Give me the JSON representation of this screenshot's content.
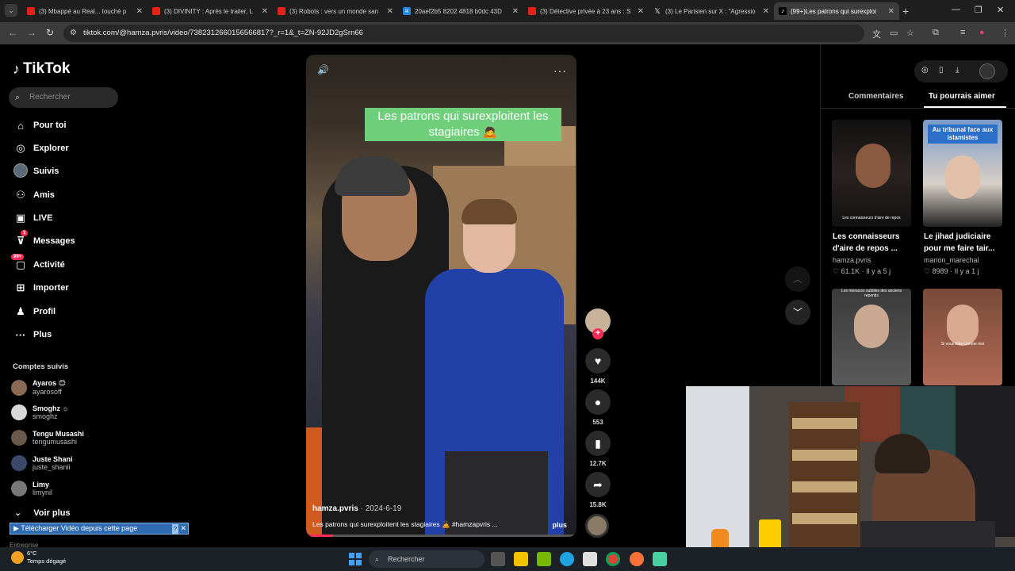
{
  "browser": {
    "tabs": [
      {
        "title": "(3) Mbappé au Real... touché p",
        "icon": "youtube-icon",
        "active": false
      },
      {
        "title": "(3) DIVINITY : Après le trailer, L",
        "icon": "youtube-icon",
        "active": false
      },
      {
        "title": "(3) Robots : vers un monde san",
        "icon": "youtube-icon",
        "active": false
      },
      {
        "title": "20aef2b5 8202 4818 b0dc 43D",
        "icon": "document-icon",
        "active": false
      },
      {
        "title": "(3) Détective privée à 23 ans : S",
        "icon": "youtube-icon",
        "active": false
      },
      {
        "title": "(3) Le Parisien sur X : \"Agressio",
        "icon": "x-icon",
        "active": false
      },
      {
        "title": "(99+)Les patrons qui surexploi",
        "icon": "tiktok-icon",
        "active": true
      }
    ],
    "url": "tiktok.com/@hamza.pvris/video/7382312660156566817?_r=1&_t=ZN-92JD2gSrn66"
  },
  "sidebar": {
    "logo": "TikTok",
    "search_placeholder": "Rechercher",
    "nav": [
      {
        "label": "Pour toi",
        "icon": "home-icon"
      },
      {
        "label": "Explorer",
        "icon": "compass-icon"
      },
      {
        "label": "Suivis",
        "icon": "following-icon"
      },
      {
        "label": "Amis",
        "icon": "friends-icon"
      },
      {
        "label": "LIVE",
        "icon": "live-icon"
      },
      {
        "label": "Messages",
        "icon": "messages-icon",
        "badge": "1"
      },
      {
        "label": "Activité",
        "icon": "activity-icon",
        "badge": "99+"
      },
      {
        "label": "Importer",
        "icon": "upload-icon"
      },
      {
        "label": "Profil",
        "icon": "profile-icon"
      },
      {
        "label": "Plus",
        "icon": "more-icon"
      }
    ],
    "following_title": "Comptes suivis",
    "accounts": [
      {
        "name": "Ayaros 😊",
        "handle": "ayarosoff",
        "color": "#8a6a52"
      },
      {
        "name": "Smoghz ☼",
        "handle": "smoghz",
        "color": "#d8d8d8"
      },
      {
        "name": "Tengu Musashi",
        "handle": "tengumusashi",
        "color": "#6a5a4a"
      },
      {
        "name": "Juste Shani",
        "handle": "juste_shanii",
        "color": "#3a4a6a"
      },
      {
        "name": "Limy",
        "handle": "limynil",
        "color": "#777777"
      }
    ],
    "see_more": "Voir plus",
    "download_bar": "Télécharger Vidéo depuis cette page",
    "footer": "Entreprise"
  },
  "video": {
    "overlay_caption": "Les patrons qui surexploitent les stagiaires 🙇",
    "author": "hamza.pvris",
    "date": "2024-6-19",
    "description": "Les patrons qui surexploitent les stagiaires 🙇 #hamzapvris ...",
    "more_label": "plus",
    "progress": 0.1
  },
  "actions": {
    "likes": "144K",
    "comments": "553",
    "saves": "12.7K",
    "shares": "15.8K"
  },
  "right_panel": {
    "tabs": [
      "Commentaires",
      "Tu pourrais aimer"
    ],
    "active_tab": "Tu pourrais aimer",
    "recommendations": [
      {
        "title": "Les connaisseurs d'aire de repos ...",
        "author": "hamza.pvris",
        "likes": "61.1K",
        "ago": "Il y a 5 j",
        "overlay": "Les connaisseurs d'aire de repos"
      },
      {
        "title": "Le jihad judiciaire pour me faire tair...",
        "author": "marion_marechal",
        "likes": "8989",
        "ago": "Il y a 1 j",
        "badge": "Au tribunal face aux islamistes"
      },
      {
        "overlay": "Les menaces subtiles des anciens repentis"
      },
      {
        "overlay": "Si vous êtes comme moi"
      }
    ]
  },
  "taskbar": {
    "temperature": "6°C",
    "weather": "Temps dégagé",
    "search_placeholder": "Rechercher"
  }
}
